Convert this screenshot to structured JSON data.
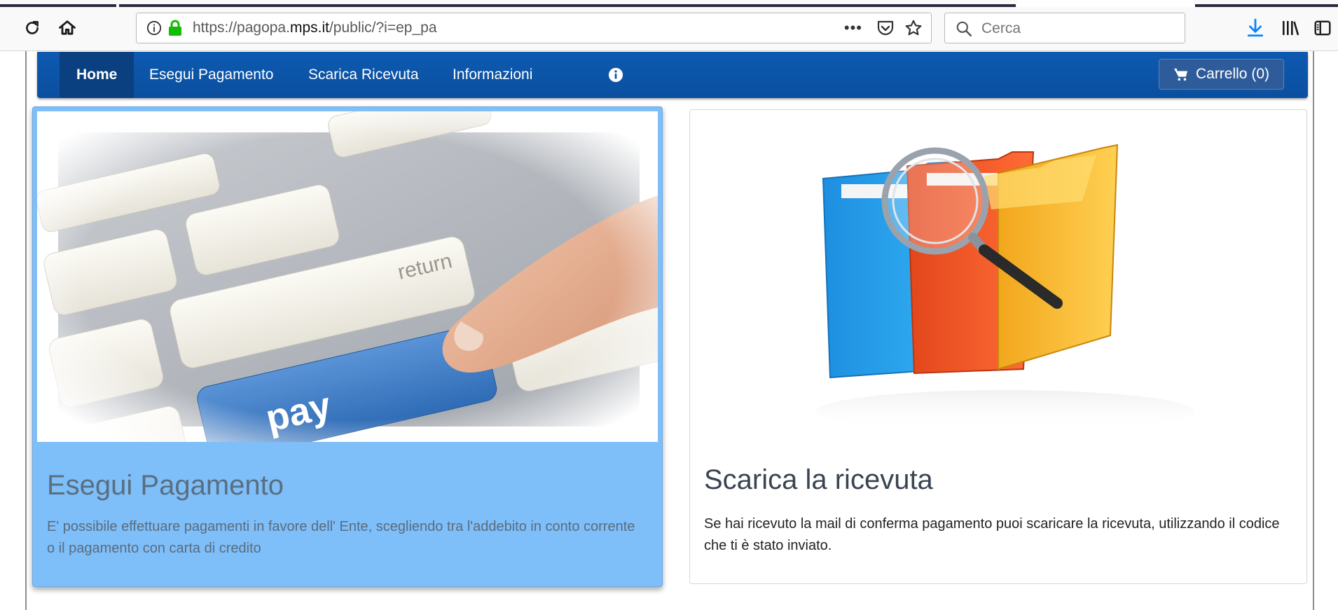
{
  "browser": {
    "url_prefix": "https://pagopa.",
    "url_domain": "mps.it",
    "url_path": "/public/?i=ep_pa",
    "more_label": "•••",
    "search_placeholder": "Cerca",
    "icons": [
      "reload-icon",
      "home-icon",
      "info-icon",
      "lock-icon",
      "page-actions-icon",
      "pocket-icon",
      "bookmark-star-icon",
      "search-icon",
      "download-icon",
      "library-icon",
      "sidebar-icon"
    ]
  },
  "nav": {
    "items": [
      {
        "label": "Home",
        "active": true
      },
      {
        "label": "Esegui Pagamento"
      },
      {
        "label": "Scarica Ricevuta"
      },
      {
        "label": "Informazioni"
      }
    ],
    "cart_label": "Carrello (0)"
  },
  "cards": {
    "pay": {
      "title": "Esegui Pagamento",
      "text": "E' possibile effettuare pagamenti in favore dell' Ente, scegliendo tra l'addebito in conto corrente o il pagamento con carta di credito",
      "key_label": "pay",
      "return_label": "return"
    },
    "receipt": {
      "title": "Scarica la ricevuta",
      "text": "Se hai ricevuto la mail di conferma pagamento puoi scaricare la ricevuta, utilizzando il codice che ti è stato inviato."
    }
  },
  "colors": {
    "navbar": "#0d5ab1",
    "nav_active": "#0a3f80",
    "pay_card_bg": "#7ebef9",
    "download_icon": "#0a84ff",
    "lock": "#12bc00"
  }
}
